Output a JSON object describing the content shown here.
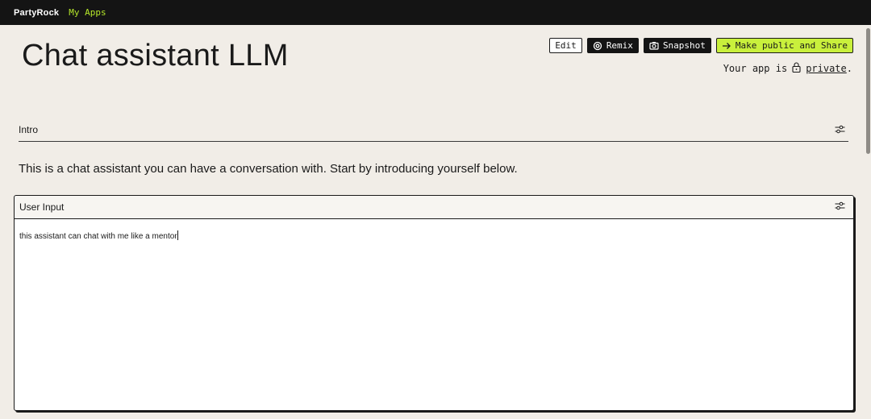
{
  "topbar": {
    "brand": "PartyRock",
    "my_apps": "My Apps"
  },
  "page": {
    "title": "Chat assistant LLM"
  },
  "actions": {
    "edit": "Edit",
    "remix": "Remix",
    "snapshot": "Snapshot",
    "share": "Make public and Share"
  },
  "privacy": {
    "prefix": "Your app is",
    "status": "private",
    "suffix": "."
  },
  "intro": {
    "label": "Intro",
    "text": "This is a chat assistant you can have a conversation with. Start by introducing yourself below."
  },
  "user_input": {
    "label": "User Input",
    "value": "this assistant can chat with me like a mentor"
  },
  "icons": {
    "remix": "remix-icon",
    "snapshot": "camera-icon",
    "share": "arrow-right-icon",
    "privacy": "lock-icon",
    "settings": "sliders-icon"
  },
  "colors": {
    "background": "#f1ede7",
    "topbar": "#141414",
    "accent_green": "#c9f03c",
    "link_green": "#b6e82a"
  }
}
